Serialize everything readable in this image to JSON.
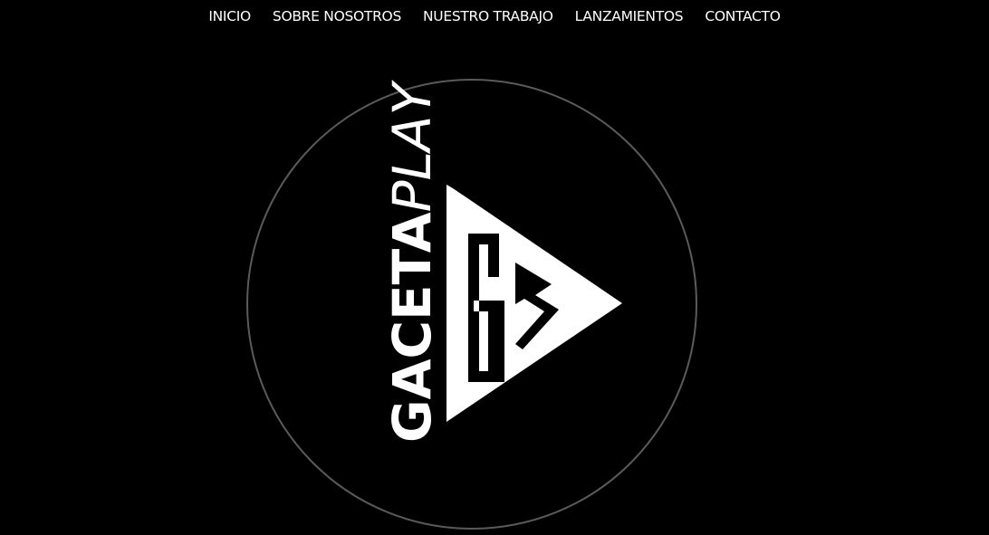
{
  "nav": {
    "items": [
      {
        "label": "INICIO"
      },
      {
        "label": "SOBRE NOSOTROS"
      },
      {
        "label": "NUESTRO TRABAJO"
      },
      {
        "label": "LANZAMIENTOS"
      },
      {
        "label": "CONTACTO"
      }
    ]
  },
  "logo": {
    "brand_bold": "GACETA",
    "brand_light": "PLAY",
    "circle_color": "#5a5a5a",
    "mark_color": "#ffffff",
    "icon": "gp-triangle-logo-icon"
  },
  "colors": {
    "background": "#000000",
    "text": "#ffffff"
  }
}
